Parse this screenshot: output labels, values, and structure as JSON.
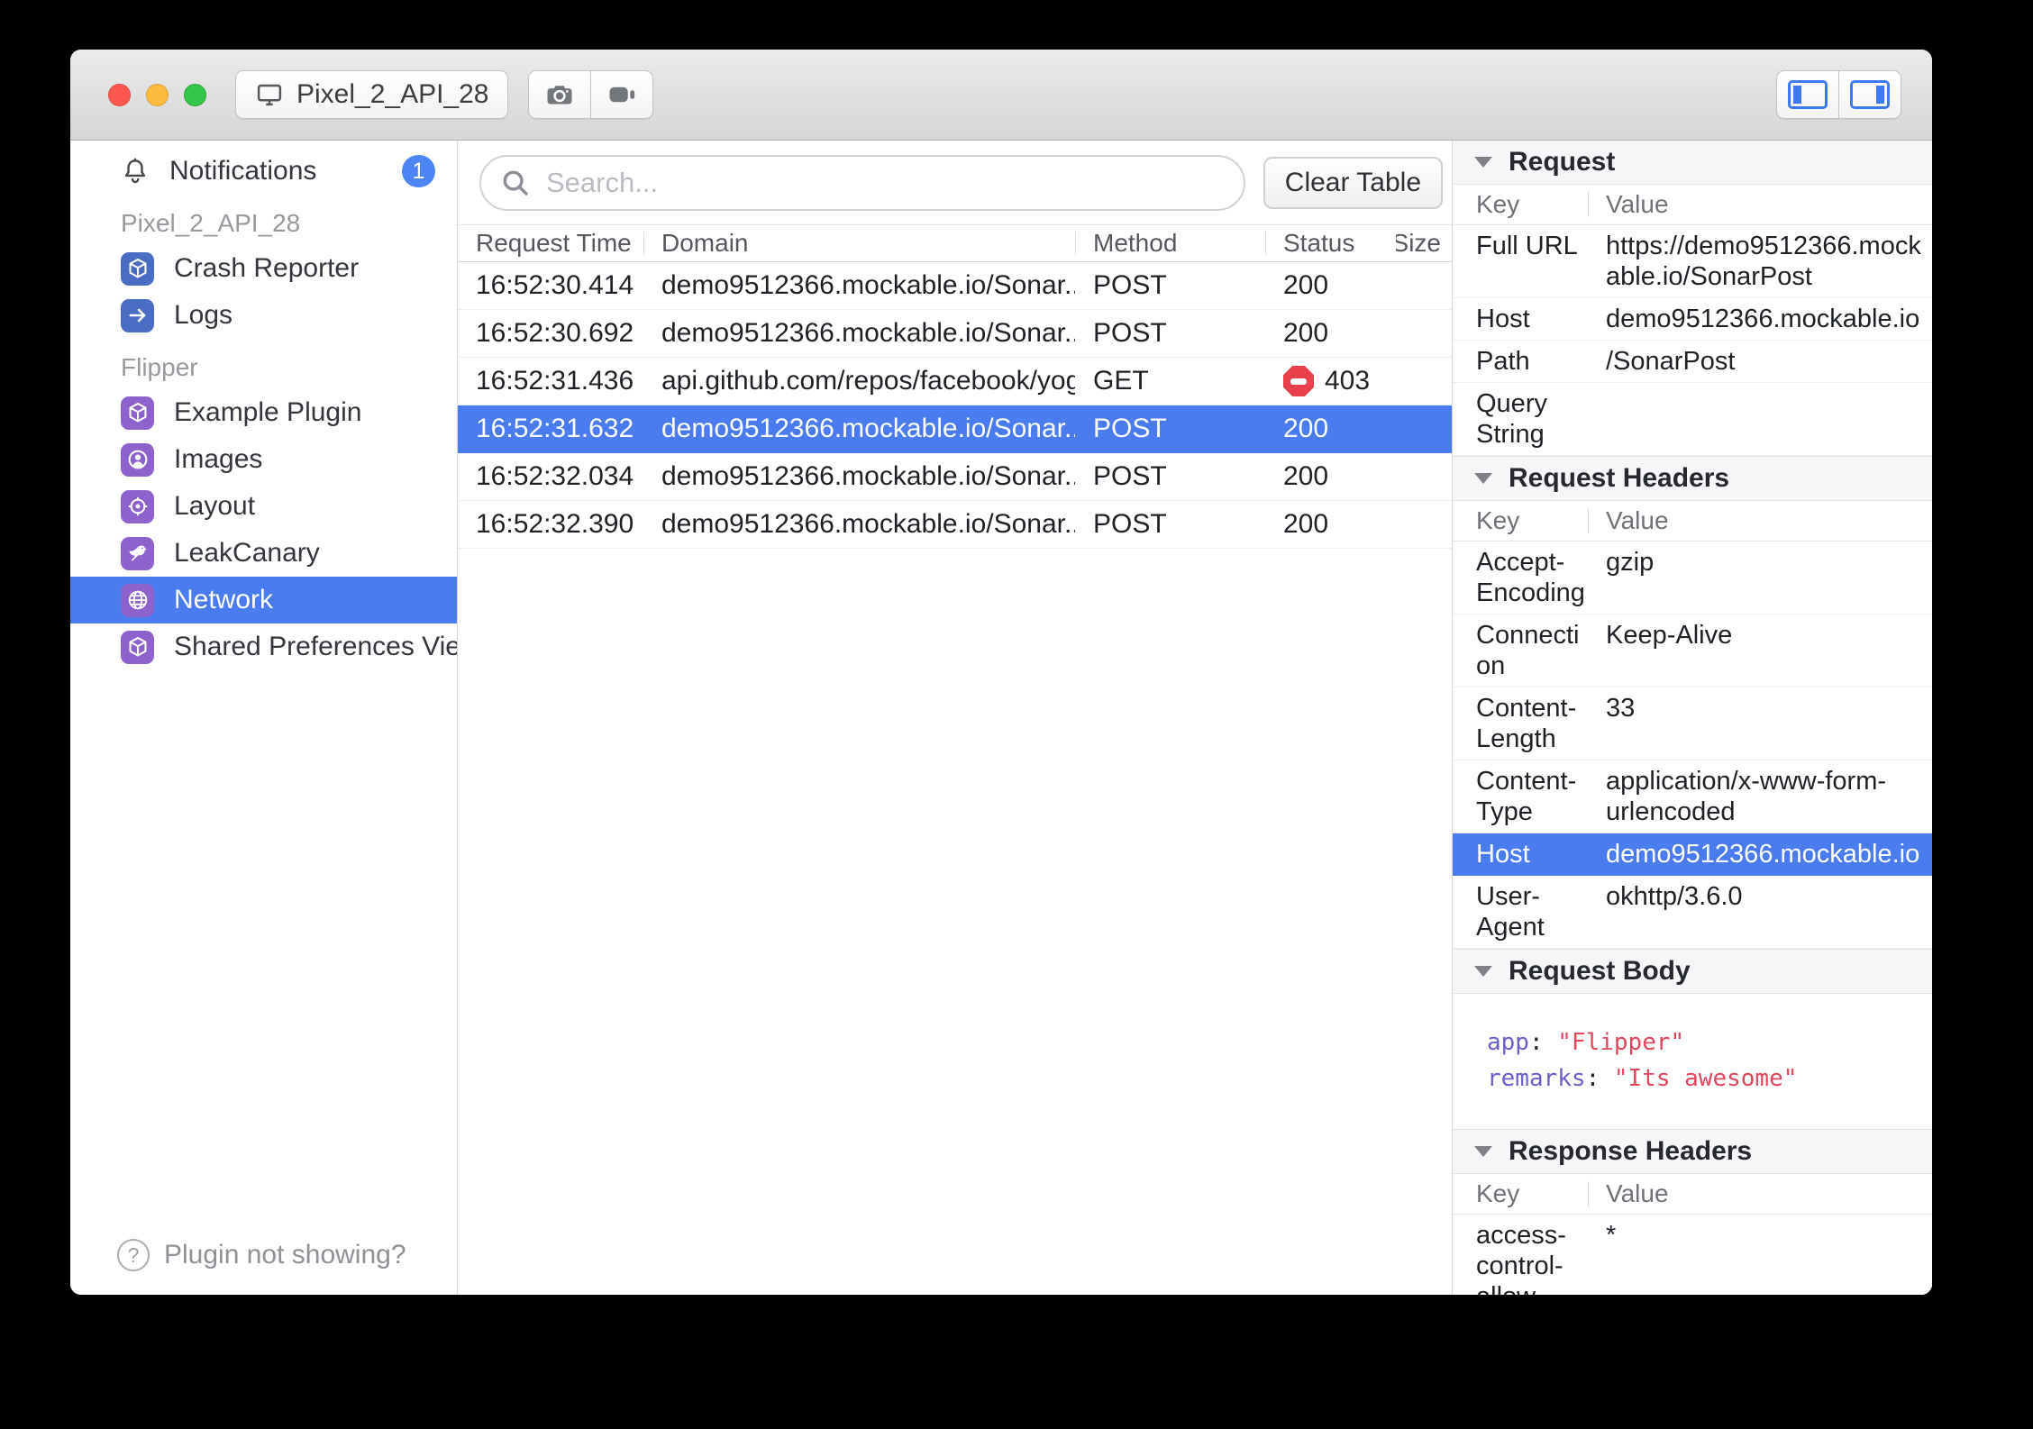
{
  "colors": {
    "accent": "#4a7cf0",
    "badge": "#4d85f6",
    "toggle-blue": "#3d78f5",
    "icon-blue": "#4a6cc3",
    "icon-purple": "#8d62cc",
    "error": "#e8414b",
    "code-key": "#6a5ecb",
    "code-string": "#e0465e",
    "traffic-red": "#fc5850",
    "traffic-yellow": "#fdbc40",
    "traffic-green": "#34c84a"
  },
  "icons": {
    "device": "monitor-icon",
    "screenshot": "camera-icon",
    "record": "video-camera-icon",
    "toggle_left": "left-pane-icon",
    "toggle_right": "right-pane-icon",
    "notifications": "bell-icon",
    "crash_reporter": "cube-icon",
    "logs": "arrow-right-icon",
    "example_plugin": "cube-icon",
    "images": "user-circle-icon",
    "layout": "target-icon",
    "leakcanary": "bird-icon",
    "network": "globe-icon",
    "shared_preferences": "cube-icon",
    "help": "question-circle-icon",
    "search": "magnifier-icon",
    "status_error": "no-entry-icon",
    "section_collapse": "triangle-down-icon"
  },
  "titlebar": {
    "device_name": "Pixel_2_API_28"
  },
  "sidebar": {
    "notifications": {
      "label": "Notifications",
      "badge": "1"
    },
    "device_section": {
      "title": "Pixel_2_API_28",
      "items": [
        {
          "label": "Crash Reporter"
        },
        {
          "label": "Logs"
        }
      ]
    },
    "flipper_section": {
      "title": "Flipper",
      "items": [
        {
          "label": "Example Plugin"
        },
        {
          "label": "Images"
        },
        {
          "label": "Layout"
        },
        {
          "label": "LeakCanary"
        },
        {
          "label": "Network",
          "selected": true
        },
        {
          "label": "Shared Preferences Viewer"
        }
      ]
    },
    "help_label": "Plugin not showing?"
  },
  "main": {
    "search_placeholder": "Search...",
    "clear_table_label": "Clear Table",
    "columns": [
      "Request Time",
      "Domain",
      "Method",
      "Status",
      "Size"
    ],
    "rows": [
      {
        "time": "16:52:30.414",
        "domain": "demo9512366.mockable.io/Sonar...",
        "method": "POST",
        "status": "200",
        "size": ""
      },
      {
        "time": "16:52:30.692",
        "domain": "demo9512366.mockable.io/Sonar...",
        "method": "POST",
        "status": "200",
        "size": ""
      },
      {
        "time": "16:52:31.436",
        "domain": "api.github.com/repos/facebook/yoga",
        "method": "GET",
        "status": "403",
        "size": "",
        "error": true
      },
      {
        "time": "16:52:31.632",
        "domain": "demo9512366.mockable.io/Sonar...",
        "method": "POST",
        "status": "200",
        "size": "",
        "selected": true
      },
      {
        "time": "16:52:32.034",
        "domain": "demo9512366.mockable.io/Sonar...",
        "method": "POST",
        "status": "200",
        "size": ""
      },
      {
        "time": "16:52:32.390",
        "domain": "demo9512366.mockable.io/Sonar...",
        "method": "POST",
        "status": "200",
        "size": ""
      }
    ]
  },
  "details": {
    "kv": {
      "key": "Key",
      "value": "Value"
    },
    "request": {
      "title": "Request",
      "rows": [
        {
          "key": "Full URL",
          "value": "https://demo9512366.mockable.io/SonarPost"
        },
        {
          "key": "Host",
          "value": "demo9512366.mockable.io"
        },
        {
          "key": "Path",
          "value": "/SonarPost"
        },
        {
          "key": "Query String",
          "value": ""
        }
      ]
    },
    "request_headers": {
      "title": "Request Headers",
      "rows": [
        {
          "key": "Accept-Encoding",
          "value": "gzip"
        },
        {
          "key": "Connection",
          "value": "Keep-Alive"
        },
        {
          "key": "Content-Length",
          "value": "33"
        },
        {
          "key": "Content-Type",
          "value": "application/x-www-form-urlencoded"
        },
        {
          "key": "Host",
          "value": "demo9512366.mockable.io",
          "selected": true
        },
        {
          "key": "User-Agent",
          "value": "okhttp/3.6.0"
        }
      ]
    },
    "request_body": {
      "title": "Request Body",
      "lines": [
        {
          "key": "app",
          "sep": ":",
          "value": "\"Flipper\""
        },
        {
          "key": "remarks",
          "sep": ":",
          "value": "\"Its awesome\""
        }
      ]
    },
    "response_headers": {
      "title": "Response Headers",
      "rows": [
        {
          "key": "access-control-allow-origin",
          "value": "*"
        }
      ]
    }
  }
}
